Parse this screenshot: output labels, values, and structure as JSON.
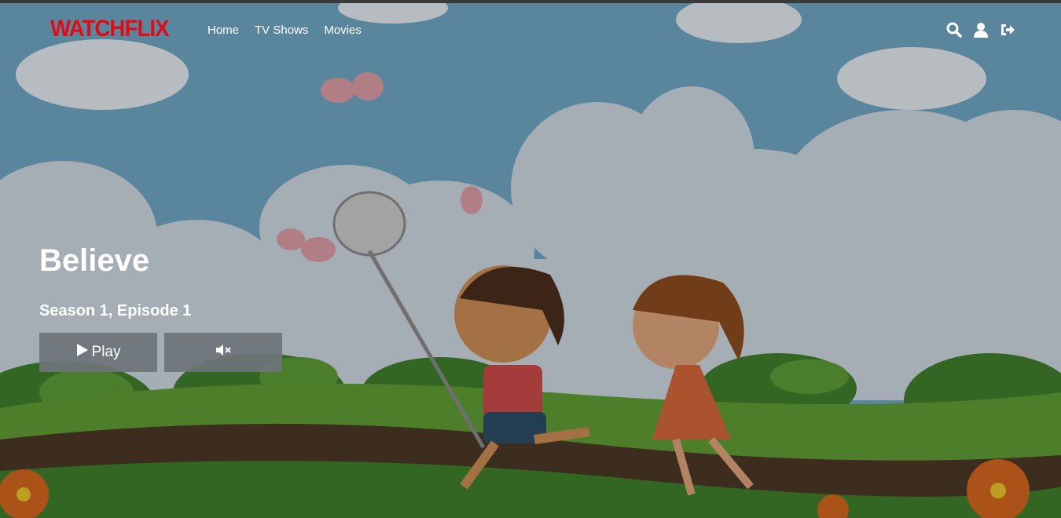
{
  "brand": {
    "logo": "WATCHFLIX",
    "color": "#e50914"
  },
  "nav": {
    "links": [
      "Home",
      "TV Shows",
      "Movies"
    ],
    "icons": [
      "search-icon",
      "user-icon",
      "sign-out-icon"
    ]
  },
  "hero": {
    "title": "Believe",
    "subtitle": "Season 1, Episode 1",
    "play_label": "Play",
    "mute_icon": "volume-mute-icon"
  }
}
